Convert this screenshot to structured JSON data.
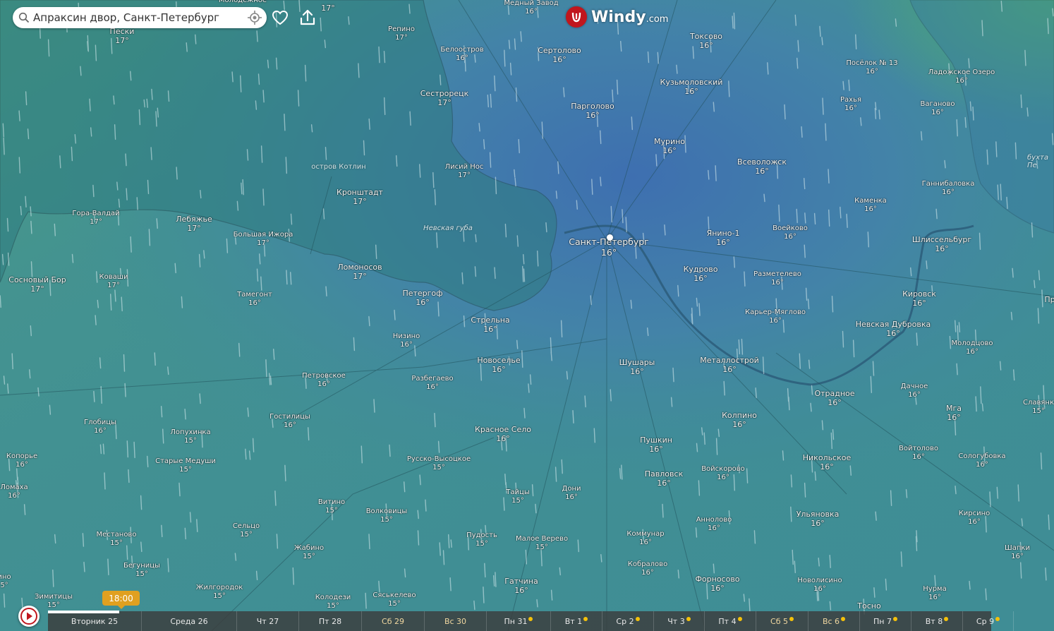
{
  "search": {
    "value": "Апраксин двор, Санкт-Петербург"
  },
  "brand": {
    "word": "Windy",
    "suffix": ".com"
  },
  "colors": {
    "timeline_bg": "#3c3c3c",
    "time_bubble": "#e0a020",
    "brand_red": "#c0161d",
    "weekend": "#f0d7a0"
  },
  "timeline": {
    "current_time": "18:00",
    "days": [
      {
        "label": "Вторник 25",
        "weekend": false
      },
      {
        "label": "Среда 26",
        "weekend": false
      },
      {
        "label": "Чт 27",
        "weekend": false
      },
      {
        "label": "Пт 28",
        "weekend": false
      },
      {
        "label": "Сб 29",
        "weekend": true
      },
      {
        "label": "Вс 30",
        "weekend": true
      },
      {
        "label": "Пн 31",
        "weekend": false,
        "sun": true
      },
      {
        "label": "Вт 1",
        "weekend": false,
        "sun": true
      },
      {
        "label": "Ср 2",
        "weekend": false,
        "sun": true
      },
      {
        "label": "Чт 3",
        "weekend": false,
        "sun": true
      },
      {
        "label": "Пт 4",
        "weekend": false,
        "sun": true
      },
      {
        "label": "Сб 5",
        "weekend": true,
        "sun": true
      },
      {
        "label": "Вс 6",
        "weekend": true,
        "sun": true
      },
      {
        "label": "Пн 7",
        "weekend": false,
        "sun": true
      },
      {
        "label": "Вт 8",
        "weekend": false,
        "sun": true
      },
      {
        "label": "Ср 9",
        "weekend": false,
        "sun": true
      }
    ]
  },
  "map": {
    "water_labels": [
      "Невская губа",
      "бухта Пе"
    ],
    "island_labels": [
      "остров Котлин"
    ],
    "cities": [
      {
        "name": "Молодёжное",
        "temp": ""
      },
      {
        "name": "",
        "temp": "17°"
      },
      {
        "name": "Медный Завод",
        "temp": "16°"
      },
      {
        "name": "Пески",
        "temp": "17°"
      },
      {
        "name": "Репино",
        "temp": "17°"
      },
      {
        "name": "Белоостров",
        "temp": "16°"
      },
      {
        "name": "Сертолово",
        "temp": "16°"
      },
      {
        "name": "Токсово",
        "temp": "16°"
      },
      {
        "name": "Посёлок № 13",
        "temp": "16°"
      },
      {
        "name": "Ладожское Озеро",
        "temp": "16°"
      },
      {
        "name": "Кузьмоловский",
        "temp": "16°"
      },
      {
        "name": "Сестрорецк",
        "temp": "17°"
      },
      {
        "name": "Парголово",
        "temp": "16°"
      },
      {
        "name": "Рахья",
        "temp": "16°"
      },
      {
        "name": "Ваганово",
        "temp": "16°"
      },
      {
        "name": "Мурино",
        "temp": "16°"
      },
      {
        "name": "Всеволожск",
        "temp": "16°"
      },
      {
        "name": "Лисий Нос",
        "temp": "17°"
      },
      {
        "name": "Ганнибаловка",
        "temp": "16°"
      },
      {
        "name": "Кронштадт",
        "temp": "17°"
      },
      {
        "name": "Каменка",
        "temp": "16°"
      },
      {
        "name": "Гора-Валдай",
        "temp": "17°"
      },
      {
        "name": "Лебяжье",
        "temp": "17°"
      },
      {
        "name": "Большая Ижора",
        "temp": "17°"
      },
      {
        "name": "Воейково",
        "temp": "16°"
      },
      {
        "name": "Янино-1",
        "temp": "16°"
      },
      {
        "name": "Санкт-Петербург",
        "temp": "16°"
      },
      {
        "name": "Шлиссельбург",
        "temp": "16°"
      },
      {
        "name": "Кудрово",
        "temp": "16°"
      },
      {
        "name": "Разметелево",
        "temp": "16°"
      },
      {
        "name": "Ломоносов",
        "temp": "17°"
      },
      {
        "name": "Сосновый Бор",
        "temp": "17°"
      },
      {
        "name": "Коваши",
        "temp": "17°"
      },
      {
        "name": "Петергоф",
        "temp": "16°"
      },
      {
        "name": "Тамегонт",
        "temp": "16°"
      },
      {
        "name": "Кировск",
        "temp": "16°"
      },
      {
        "name": "Пр",
        "temp": ""
      },
      {
        "name": "Карьер-Мяглово",
        "temp": "16°"
      },
      {
        "name": "Стрельна",
        "temp": "16°"
      },
      {
        "name": "Невская Дубровка",
        "temp": "16°"
      },
      {
        "name": "Низино",
        "temp": "16°"
      },
      {
        "name": "Молодцово",
        "temp": "16°"
      },
      {
        "name": "Новоселье",
        "temp": "16°"
      },
      {
        "name": "Шушары",
        "temp": "16°"
      },
      {
        "name": "Металлострой",
        "temp": "16°"
      },
      {
        "name": "Петровское",
        "temp": "16°"
      },
      {
        "name": "Разбегаево",
        "temp": "16°"
      },
      {
        "name": "Дачное",
        "temp": "16°"
      },
      {
        "name": "Отрадное",
        "temp": "16°"
      },
      {
        "name": "Славянк",
        "temp": "15°"
      },
      {
        "name": "Мга",
        "temp": "16°"
      },
      {
        "name": "Колпино",
        "temp": "16°"
      },
      {
        "name": "Гостилицы",
        "temp": "16°"
      },
      {
        "name": "Глобицы",
        "temp": "16°"
      },
      {
        "name": "Красное Село",
        "temp": "16°"
      },
      {
        "name": "Лопухинка",
        "temp": "15°"
      },
      {
        "name": "Пушкин",
        "temp": "16°"
      },
      {
        "name": "Войтолово",
        "temp": "16°"
      },
      {
        "name": "Копорье",
        "temp": "16°"
      },
      {
        "name": "Никольское",
        "temp": "16°"
      },
      {
        "name": "Сологубовка",
        "temp": "16°"
      },
      {
        "name": "Старые Медуши",
        "temp": "15°"
      },
      {
        "name": "Русско-Высоцкое",
        "temp": "15°"
      },
      {
        "name": "Павловск",
        "temp": "16°"
      },
      {
        "name": "Войскорово",
        "temp": "16°"
      },
      {
        "name": "Ломаха",
        "temp": "16°"
      },
      {
        "name": "Дони",
        "temp": "16°"
      },
      {
        "name": "Тайцы",
        "temp": "15°"
      },
      {
        "name": "Витино",
        "temp": "15°"
      },
      {
        "name": "Волковицы",
        "temp": "15°"
      },
      {
        "name": "Ульяновка",
        "temp": "16°"
      },
      {
        "name": "Кирсино",
        "temp": "16°"
      },
      {
        "name": "Аннолово",
        "temp": "16°"
      },
      {
        "name": "Сельцо",
        "temp": "15°"
      },
      {
        "name": "Местаново",
        "temp": "15°"
      },
      {
        "name": "Коммунар",
        "temp": "16°"
      },
      {
        "name": "Пудость",
        "temp": "15°"
      },
      {
        "name": "Малое Верево",
        "temp": "15°"
      },
      {
        "name": "Жабино",
        "temp": "15°"
      },
      {
        "name": "Шапки",
        "temp": "16°"
      },
      {
        "name": "Бегуницы",
        "temp": "15°"
      },
      {
        "name": "Кобралово",
        "temp": "16°"
      },
      {
        "name": "Гатчина",
        "temp": "16°"
      },
      {
        "name": "Форносово",
        "temp": "16°"
      },
      {
        "name": "Новолисино",
        "temp": "16°"
      },
      {
        "name": "Жилгородок",
        "temp": "15°"
      },
      {
        "name": "Нурма",
        "temp": "16°"
      },
      {
        "name": "Зимитицы",
        "temp": "15°"
      },
      {
        "name": "Колодези",
        "temp": "15°"
      },
      {
        "name": "Сяськелево",
        "temp": "15°"
      },
      {
        "name": "Тосно",
        "temp": ""
      },
      {
        "name": "ино",
        "temp": "5°"
      }
    ]
  }
}
